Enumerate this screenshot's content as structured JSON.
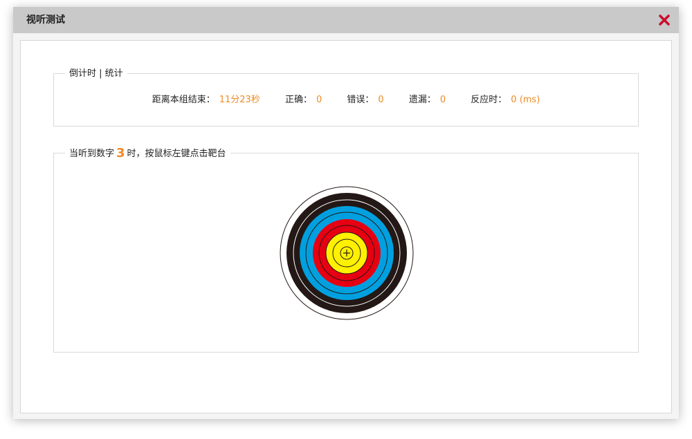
{
  "dialog": {
    "title": "视听测试",
    "close_icon": "close-icon"
  },
  "stats": {
    "legend": "倒计时 | 统计",
    "remaining_label": "距离本组结束：",
    "remaining_value": "11分23秒",
    "correct_label": "正确：",
    "correct_value": "0",
    "wrong_label": "错误：",
    "wrong_value": "0",
    "missed_label": "遗漏：",
    "missed_value": "0",
    "reaction_label": "反应时：",
    "reaction_value": "0 (ms)"
  },
  "instruction": {
    "prefix": "当听到数字",
    "number": "3",
    "suffix": "时，按鼠标左键点击靶台"
  },
  "colors": {
    "accent": "#f08a24",
    "close": "#c8102e",
    "ring_white": "#ffffff",
    "ring_black": "#231815",
    "ring_blue": "#00a0e0",
    "ring_red": "#e60012",
    "ring_yellow": "#fff100"
  },
  "icons": {
    "target": "archery-target-icon",
    "crosshair": "crosshair-icon"
  }
}
